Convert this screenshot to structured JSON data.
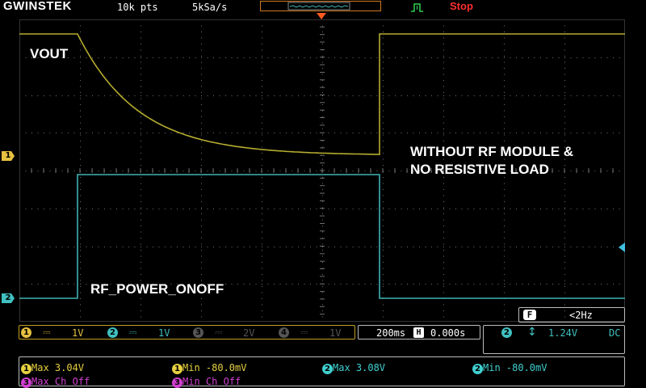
{
  "brand": "GWINSTEK",
  "header": {
    "points": "10k pts",
    "sample_rate": "5kSa/s",
    "run_state": "Stop"
  },
  "channels": [
    {
      "id": "1",
      "color": "#b5ac2f",
      "label": "VOUT",
      "scale": "1V"
    },
    {
      "id": "2",
      "color": "#3fb2b3",
      "label": "RF_POWER_ONOFF",
      "scale": "1V"
    },
    {
      "id": "3",
      "color": "#7a7a7a",
      "scale": "2V"
    },
    {
      "id": "4",
      "color": "#7a7a7a",
      "scale": "1V"
    }
  ],
  "annotation": {
    "line1": "WITHOUT RF MODULE &",
    "line2": "NO RESISTIVE LOAD"
  },
  "trigger": {
    "mode_icon": "F",
    "freq": "<2Hz",
    "source": "2",
    "level": "1.24V",
    "coupling": "DC"
  },
  "timebase": {
    "scale": "200ms",
    "position_icon": "H",
    "position": "0.000s"
  },
  "measurements": {
    "row1": [
      {
        "ch": "1",
        "text": "Max 3.04V",
        "color": "#e6d040"
      },
      {
        "ch": "1",
        "text": "Min -80.0mV",
        "color": "#e6d040"
      },
      {
        "ch": "2",
        "text": "Max 3.08V",
        "color": "#40d0d0"
      },
      {
        "ch": "2",
        "text": "Min -80.0mV",
        "color": "#40d0d0"
      }
    ],
    "row2": [
      {
        "ch": "3",
        "text": "Max Ch Off",
        "color": "#d040d0"
      },
      {
        "ch": "3",
        "text": "Min Ch Off",
        "color": "#d040d0"
      }
    ]
  },
  "colors": {
    "ch1_trace": "#b5ac2f",
    "ch2_trace": "#3fb2b3",
    "grid": "#707070",
    "stop": "#ff3030",
    "trigger_marker": "#ff5a1e"
  }
}
